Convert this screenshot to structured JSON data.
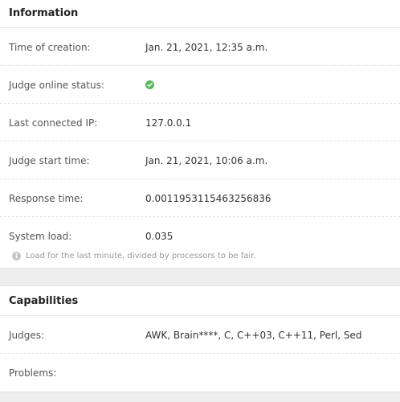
{
  "information": {
    "heading": "Information",
    "rows": [
      {
        "label": "Time of creation:",
        "value": "Jan. 21, 2021, 12:35 a.m."
      },
      {
        "label": "Judge online status:",
        "value": ""
      },
      {
        "label": "Last connected IP:",
        "value": "127.0.0.1"
      },
      {
        "label": "Judge start time:",
        "value": "Jan. 21, 2021, 10:06 a.m."
      },
      {
        "label": "Response time:",
        "value": "0.0011953115463256836"
      },
      {
        "label": "System load:",
        "value": "0.035"
      }
    ],
    "online_status_icon": "check-circle-icon",
    "online_status_color": "#5cb85c",
    "note": "Load for the last minute, divided by processors to be fair.",
    "note_icon": "info-icon"
  },
  "capabilities": {
    "heading": "Capabilities",
    "rows": [
      {
        "label": "Judges:",
        "value": "AWK, Brain****, C, C++03, C++11, Perl, Sed"
      },
      {
        "label": "Problems:",
        "value": ""
      }
    ]
  }
}
